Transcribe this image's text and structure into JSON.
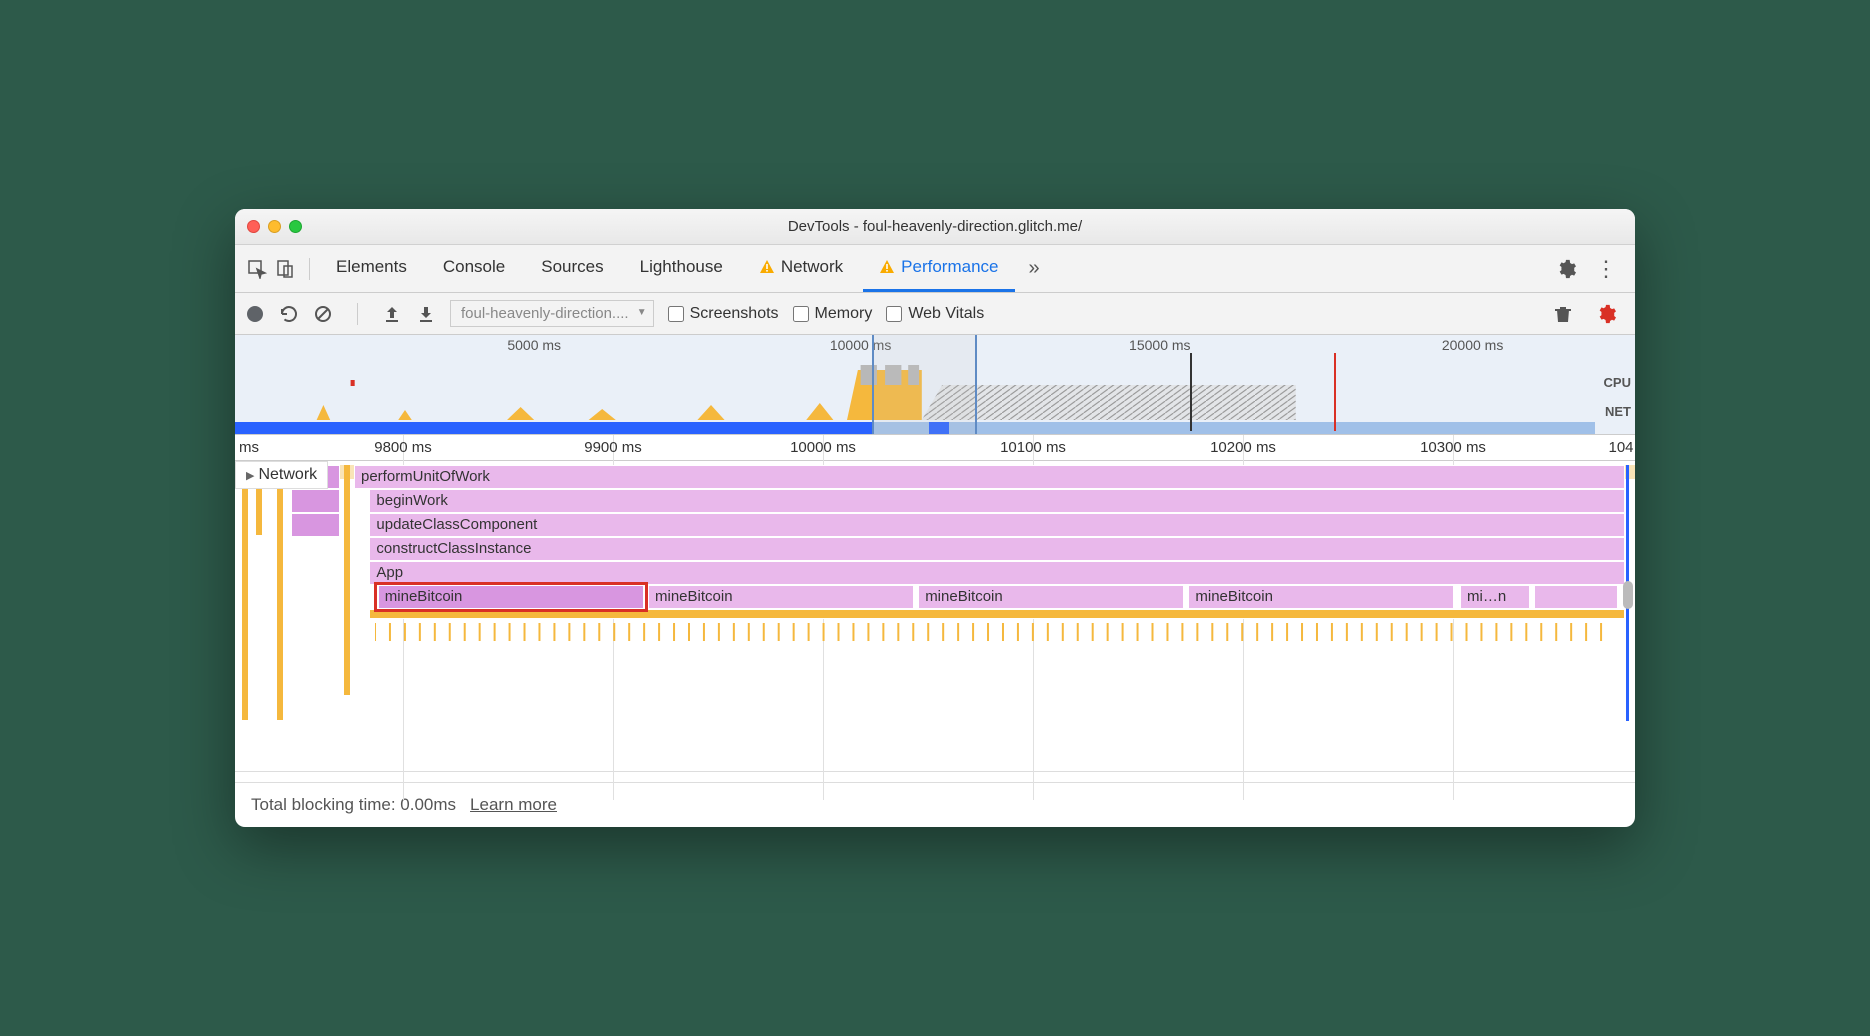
{
  "title": "DevTools - foul-heavenly-direction.glitch.me/",
  "tabs": [
    "Elements",
    "Console",
    "Sources",
    "Lighthouse",
    "Network",
    "Performance"
  ],
  "activeTab": "Performance",
  "toolbar": {
    "dropdown": "foul-heavenly-direction....",
    "screenshots": "Screenshots",
    "memory": "Memory",
    "webvitals": "Web Vitals"
  },
  "overview": {
    "ticks": [
      "5000 ms",
      "10000 ms",
      "15000 ms",
      "20000 ms"
    ],
    "cpuLabel": "CPU",
    "netLabel": "NET"
  },
  "ruler": {
    "ticks": [
      "ms",
      "9800 ms",
      "9900 ms",
      "10000 ms",
      "10100 ms",
      "10200 ms",
      "10300 ms",
      "104"
    ]
  },
  "trackLabel": "Network",
  "frames": {
    "performUnit": "performUnitOfWork",
    "beginWork": "beginWork",
    "updateClass": "updateClassComponent",
    "constructClass": "constructClassInstance",
    "app": "App",
    "mine1": "mineBitcoin",
    "mine2": "mineBitcoin",
    "mine3": "mineBitcoin",
    "mine4": "mineBitcoin",
    "mine5": "mi…n"
  },
  "footer": {
    "text": "Total blocking time: 0.00ms",
    "link": "Learn more"
  }
}
